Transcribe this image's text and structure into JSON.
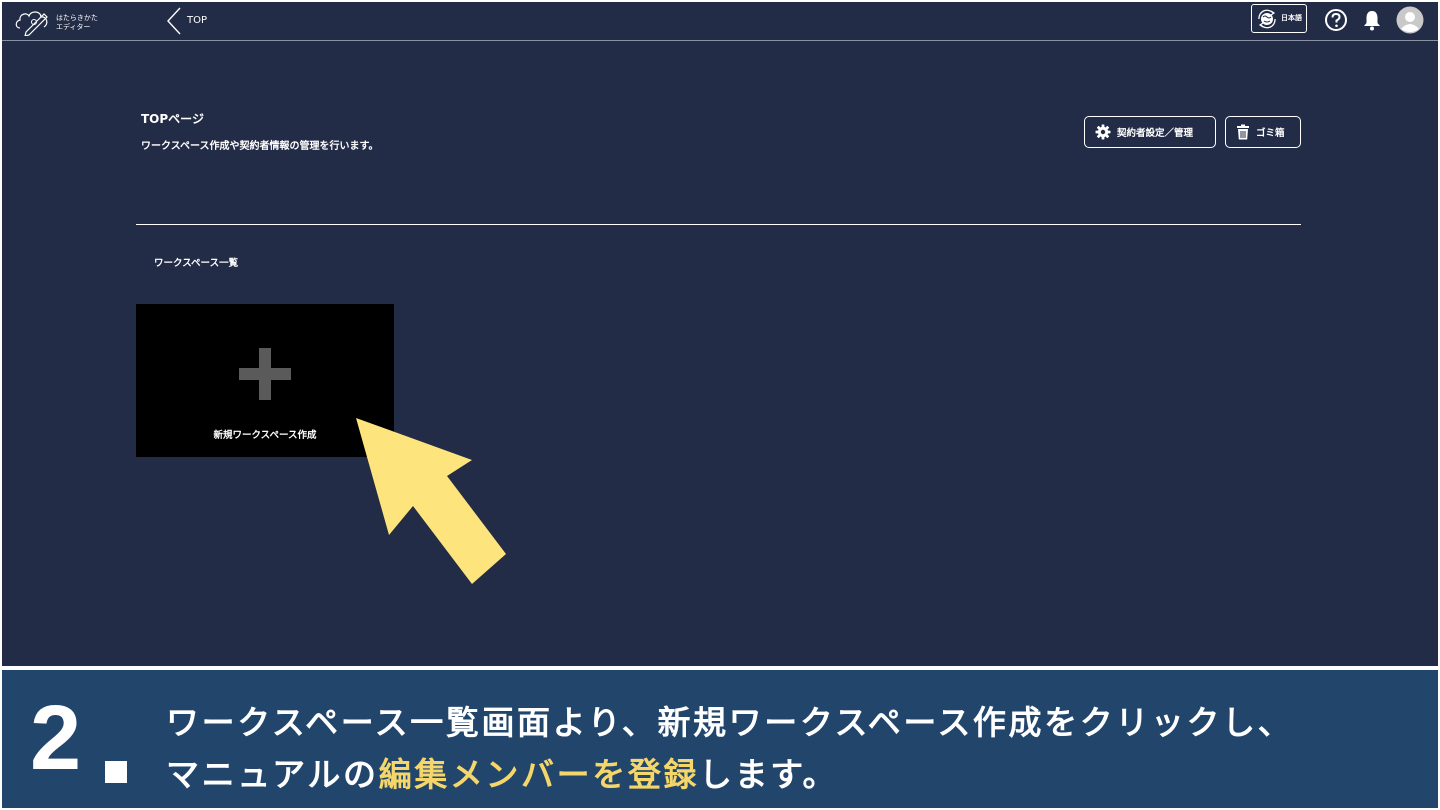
{
  "header": {
    "logo_line1": "はたらきかた",
    "logo_line2": "エディター",
    "breadcrumb": "TOP",
    "language_label": "日本語"
  },
  "page": {
    "title": "TOPページ",
    "description": "ワークスペース作成や契約者情報の管理を行います。",
    "contract_settings_label": "契約者設定／管理",
    "trash_label": "ゴミ箱",
    "section_title": "ワークスペース一覧",
    "new_workspace_label": "新規ワークスペース作成"
  },
  "caption": {
    "step": "2",
    "line1": "ワークスペース一覧画面より、新規ワークスペース作成をクリックし、",
    "line2_pre": "マニュアルの",
    "line2_hl1": "編集",
    "line2_hl2": "メンバーを",
    "line2_hl3": "登録",
    "line2_post": "します。"
  },
  "colors": {
    "background": "#232c47",
    "caption_band": "#22456b",
    "highlight": "#f4d66b",
    "arrow": "#fde47c",
    "card": "#000000"
  },
  "icons": [
    "cloud-pencil-logo-icon",
    "chevron-left-icon",
    "globe-sync-icon",
    "help-icon",
    "bell-icon",
    "user-avatar-icon",
    "gear-icon",
    "trash-icon",
    "plus-icon",
    "pointer-arrow-icon"
  ]
}
